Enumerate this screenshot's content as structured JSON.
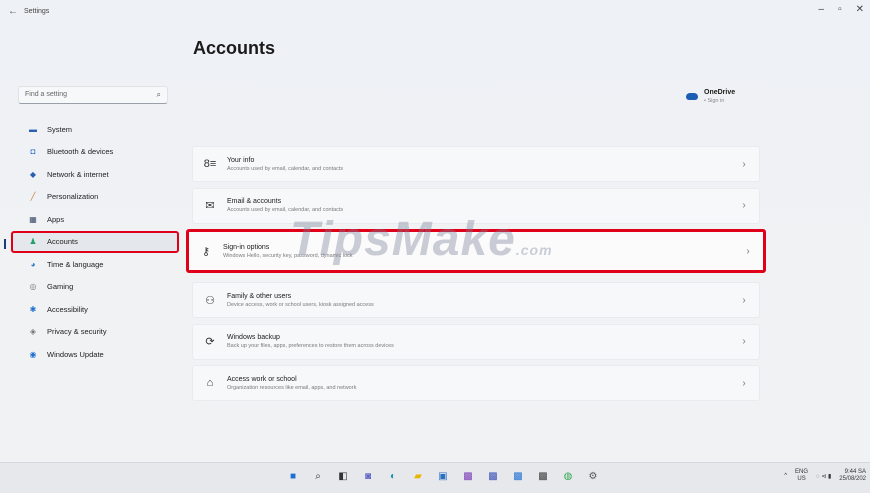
{
  "window": {
    "title": "Settings",
    "back": "←",
    "controls": [
      "–",
      "▫",
      "✕"
    ]
  },
  "page": {
    "title": "Accounts"
  },
  "search": {
    "placeholder": "Find a setting"
  },
  "sidebar": {
    "items": [
      {
        "label": "System",
        "icon": "display-icon",
        "glyph": "▬",
        "color": "#2b5fb0"
      },
      {
        "label": "Bluetooth & devices",
        "icon": "bluetooth-icon",
        "glyph": "◘",
        "color": "#1f6fd1"
      },
      {
        "label": "Network & internet",
        "icon": "wifi-icon",
        "glyph": "◆",
        "color": "#2b5fb0"
      },
      {
        "label": "Personalization",
        "icon": "brush-icon",
        "glyph": "╱",
        "color": "#c0763a"
      },
      {
        "label": "Apps",
        "icon": "apps-icon",
        "glyph": "▦",
        "color": "#3a4a66"
      },
      {
        "label": "Accounts",
        "icon": "person-icon",
        "glyph": "♟",
        "color": "#22a06b",
        "active": true
      },
      {
        "label": "Time & language",
        "icon": "globe-clock-icon",
        "glyph": "◕",
        "color": "#2b7fc0"
      },
      {
        "label": "Gaming",
        "icon": "gamepad-icon",
        "glyph": "◎",
        "color": "#777777"
      },
      {
        "label": "Accessibility",
        "icon": "accessibility-icon",
        "glyph": "✱",
        "color": "#1f6fd1"
      },
      {
        "label": "Privacy & security",
        "icon": "shield-icon",
        "glyph": "◈",
        "color": "#777777"
      },
      {
        "label": "Windows Update",
        "icon": "update-icon",
        "glyph": "◉",
        "color": "#1f6fd1"
      }
    ]
  },
  "onedrive": {
    "title": "OneDrive",
    "subtitle": "• Sign in"
  },
  "cards": [
    {
      "title": "Your info",
      "subtitle": "Accounts used by email, calendar, and contacts",
      "icon": "id-card-icon",
      "glyph": "8≡"
    },
    {
      "title": "Email & accounts",
      "subtitle": "Accounts used by email, calendar, and contacts",
      "icon": "mail-icon",
      "glyph": "✉"
    },
    {
      "title": "Sign-in options",
      "subtitle": "Windows Hello, security key, password, dynamic lock",
      "icon": "key-icon",
      "glyph": "⚷",
      "highlight": true
    },
    {
      "title": "Family & other users",
      "subtitle": "Device access, work or school users, kiosk assigned access",
      "icon": "family-icon",
      "glyph": "⚇"
    },
    {
      "title": "Windows backup",
      "subtitle": "Back up your files, apps, preferences to restore them across devices",
      "icon": "backup-icon",
      "glyph": "⟳"
    },
    {
      "title": "Access work or school",
      "subtitle": "Organization resources like email, apps, and network",
      "icon": "briefcase-icon",
      "glyph": "⌂"
    }
  ],
  "chevron": "›",
  "watermark": {
    "main": "TipsMake",
    "suffix": ".com"
  },
  "taskbar": {
    "icons": [
      {
        "name": "start-icon",
        "glyph": "■",
        "color": "#1f6fd1"
      },
      {
        "name": "search-icon",
        "glyph": "⌕",
        "color": "#333333"
      },
      {
        "name": "task-view-icon",
        "glyph": "◧",
        "color": "#333333"
      },
      {
        "name": "chat-icon",
        "glyph": "◙",
        "color": "#5b5fc7"
      },
      {
        "name": "edge-icon",
        "glyph": "◐",
        "color": "#1a8fb0"
      },
      {
        "name": "file-explorer-icon",
        "glyph": "▰",
        "color": "#e8b400"
      },
      {
        "name": "store-icon",
        "glyph": "▣",
        "color": "#2a6fc0"
      },
      {
        "name": "app-icon-1",
        "glyph": "▩",
        "color": "#7a3bb5"
      },
      {
        "name": "app-icon-2",
        "glyph": "▩",
        "color": "#3b4fb5"
      },
      {
        "name": "app-icon-3",
        "glyph": "▩",
        "color": "#1f6fd1"
      },
      {
        "name": "app-icon-4",
        "glyph": "▩",
        "color": "#3a3a3a"
      },
      {
        "name": "chrome-icon",
        "glyph": "◍",
        "color": "#2fa84f"
      },
      {
        "name": "settings-icon",
        "glyph": "⚙",
        "color": "#555555"
      }
    ],
    "tray": {
      "chevron": "^",
      "lang_top": "ENG",
      "lang_bottom": "US",
      "icons": "◌ ⊲ ▮",
      "time": "9:44 SA",
      "date": "25/08/202"
    }
  }
}
